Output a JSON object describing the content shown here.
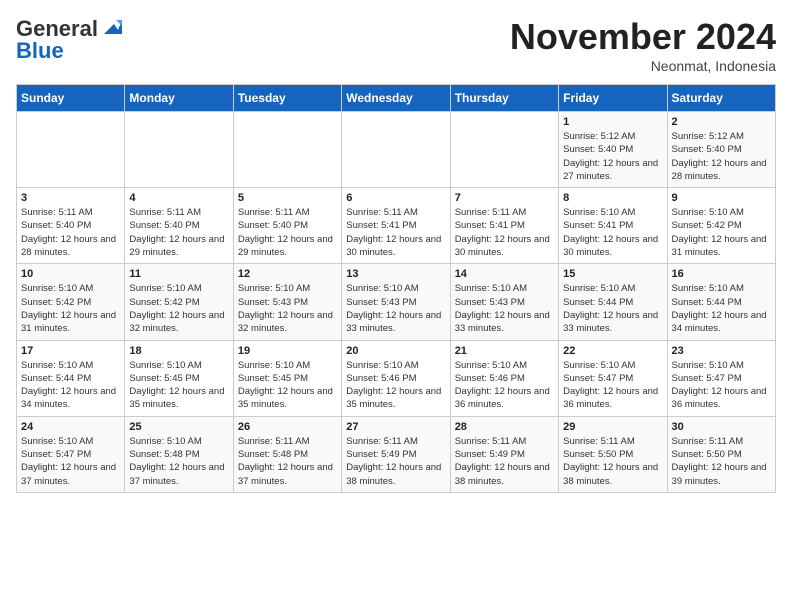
{
  "header": {
    "logo_line1": "General",
    "logo_line2": "Blue",
    "month": "November 2024",
    "location": "Neonmat, Indonesia"
  },
  "days_of_week": [
    "Sunday",
    "Monday",
    "Tuesday",
    "Wednesday",
    "Thursday",
    "Friday",
    "Saturday"
  ],
  "weeks": [
    [
      {
        "day": "",
        "info": ""
      },
      {
        "day": "",
        "info": ""
      },
      {
        "day": "",
        "info": ""
      },
      {
        "day": "",
        "info": ""
      },
      {
        "day": "",
        "info": ""
      },
      {
        "day": "1",
        "info": "Sunrise: 5:12 AM\nSunset: 5:40 PM\nDaylight: 12 hours and 27 minutes."
      },
      {
        "day": "2",
        "info": "Sunrise: 5:12 AM\nSunset: 5:40 PM\nDaylight: 12 hours and 28 minutes."
      }
    ],
    [
      {
        "day": "3",
        "info": "Sunrise: 5:11 AM\nSunset: 5:40 PM\nDaylight: 12 hours and 28 minutes."
      },
      {
        "day": "4",
        "info": "Sunrise: 5:11 AM\nSunset: 5:40 PM\nDaylight: 12 hours and 29 minutes."
      },
      {
        "day": "5",
        "info": "Sunrise: 5:11 AM\nSunset: 5:40 PM\nDaylight: 12 hours and 29 minutes."
      },
      {
        "day": "6",
        "info": "Sunrise: 5:11 AM\nSunset: 5:41 PM\nDaylight: 12 hours and 30 minutes."
      },
      {
        "day": "7",
        "info": "Sunrise: 5:11 AM\nSunset: 5:41 PM\nDaylight: 12 hours and 30 minutes."
      },
      {
        "day": "8",
        "info": "Sunrise: 5:10 AM\nSunset: 5:41 PM\nDaylight: 12 hours and 30 minutes."
      },
      {
        "day": "9",
        "info": "Sunrise: 5:10 AM\nSunset: 5:42 PM\nDaylight: 12 hours and 31 minutes."
      }
    ],
    [
      {
        "day": "10",
        "info": "Sunrise: 5:10 AM\nSunset: 5:42 PM\nDaylight: 12 hours and 31 minutes."
      },
      {
        "day": "11",
        "info": "Sunrise: 5:10 AM\nSunset: 5:42 PM\nDaylight: 12 hours and 32 minutes."
      },
      {
        "day": "12",
        "info": "Sunrise: 5:10 AM\nSunset: 5:43 PM\nDaylight: 12 hours and 32 minutes."
      },
      {
        "day": "13",
        "info": "Sunrise: 5:10 AM\nSunset: 5:43 PM\nDaylight: 12 hours and 33 minutes."
      },
      {
        "day": "14",
        "info": "Sunrise: 5:10 AM\nSunset: 5:43 PM\nDaylight: 12 hours and 33 minutes."
      },
      {
        "day": "15",
        "info": "Sunrise: 5:10 AM\nSunset: 5:44 PM\nDaylight: 12 hours and 33 minutes."
      },
      {
        "day": "16",
        "info": "Sunrise: 5:10 AM\nSunset: 5:44 PM\nDaylight: 12 hours and 34 minutes."
      }
    ],
    [
      {
        "day": "17",
        "info": "Sunrise: 5:10 AM\nSunset: 5:44 PM\nDaylight: 12 hours and 34 minutes."
      },
      {
        "day": "18",
        "info": "Sunrise: 5:10 AM\nSunset: 5:45 PM\nDaylight: 12 hours and 35 minutes."
      },
      {
        "day": "19",
        "info": "Sunrise: 5:10 AM\nSunset: 5:45 PM\nDaylight: 12 hours and 35 minutes."
      },
      {
        "day": "20",
        "info": "Sunrise: 5:10 AM\nSunset: 5:46 PM\nDaylight: 12 hours and 35 minutes."
      },
      {
        "day": "21",
        "info": "Sunrise: 5:10 AM\nSunset: 5:46 PM\nDaylight: 12 hours and 36 minutes."
      },
      {
        "day": "22",
        "info": "Sunrise: 5:10 AM\nSunset: 5:47 PM\nDaylight: 12 hours and 36 minutes."
      },
      {
        "day": "23",
        "info": "Sunrise: 5:10 AM\nSunset: 5:47 PM\nDaylight: 12 hours and 36 minutes."
      }
    ],
    [
      {
        "day": "24",
        "info": "Sunrise: 5:10 AM\nSunset: 5:47 PM\nDaylight: 12 hours and 37 minutes."
      },
      {
        "day": "25",
        "info": "Sunrise: 5:10 AM\nSunset: 5:48 PM\nDaylight: 12 hours and 37 minutes."
      },
      {
        "day": "26",
        "info": "Sunrise: 5:11 AM\nSunset: 5:48 PM\nDaylight: 12 hours and 37 minutes."
      },
      {
        "day": "27",
        "info": "Sunrise: 5:11 AM\nSunset: 5:49 PM\nDaylight: 12 hours and 38 minutes."
      },
      {
        "day": "28",
        "info": "Sunrise: 5:11 AM\nSunset: 5:49 PM\nDaylight: 12 hours and 38 minutes."
      },
      {
        "day": "29",
        "info": "Sunrise: 5:11 AM\nSunset: 5:50 PM\nDaylight: 12 hours and 38 minutes."
      },
      {
        "day": "30",
        "info": "Sunrise: 5:11 AM\nSunset: 5:50 PM\nDaylight: 12 hours and 39 minutes."
      }
    ]
  ]
}
